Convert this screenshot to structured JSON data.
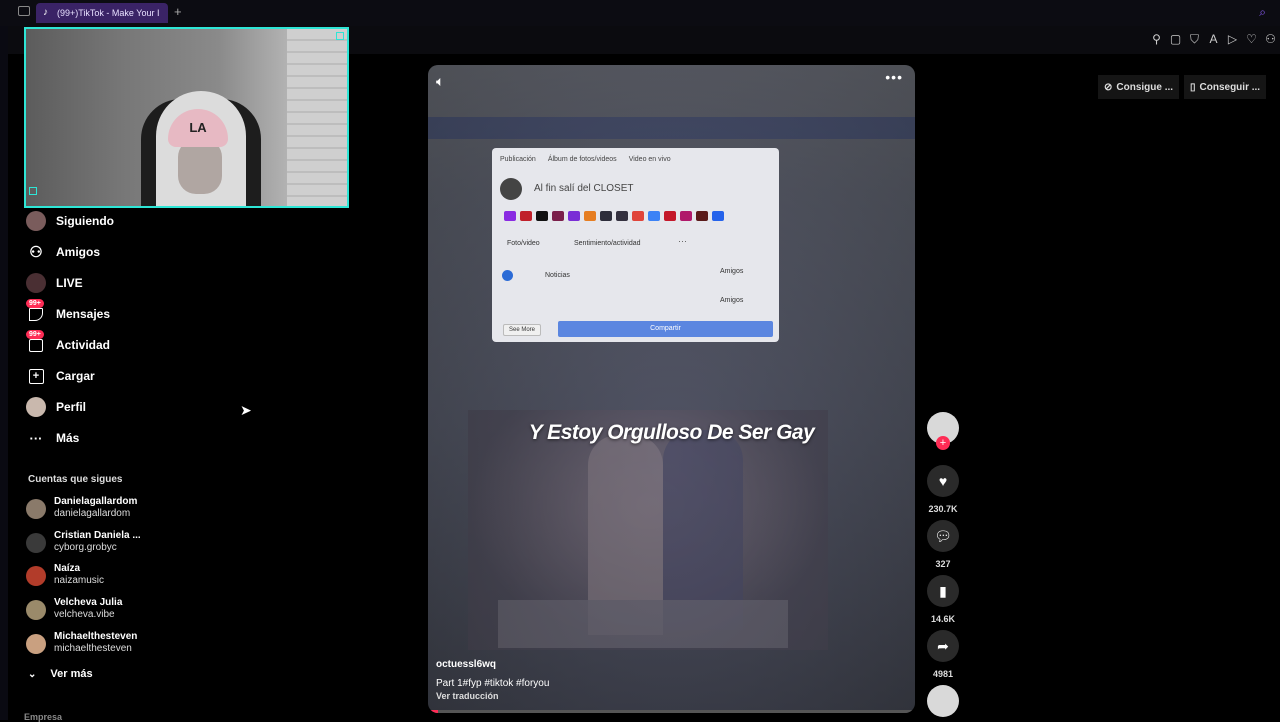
{
  "browser": {
    "tab_title": "(99+)TikTok - Make Your I",
    "new_tab": "+",
    "toolbar_icons": [
      "pin-icon",
      "screenshot-icon",
      "shield-icon",
      "translate-icon",
      "send-icon",
      "heart-icon",
      "profile-icon"
    ]
  },
  "nav": {
    "items": [
      {
        "label": "Siguiendo",
        "icon": "following-avatar-icon"
      },
      {
        "label": "Amigos",
        "icon": "friends-icon"
      },
      {
        "label": "LIVE",
        "icon": "live-icon"
      },
      {
        "label": "Mensajes",
        "icon": "messages-icon",
        "badge": "99+"
      },
      {
        "label": "Actividad",
        "icon": "activity-icon",
        "badge": "99+"
      },
      {
        "label": "Cargar",
        "icon": "upload-icon"
      },
      {
        "label": "Perfil",
        "icon": "profile-icon"
      },
      {
        "label": "Más",
        "icon": "more-icon"
      }
    ]
  },
  "following": {
    "title": "Cuentas que sigues",
    "accounts": [
      {
        "name": "Danielagallardom",
        "handle": "danielagallardom",
        "color": "#8a7a6a"
      },
      {
        "name": "Cristian Daniela ...",
        "handle": "cyborg.grobyc",
        "color": "#3a3a3a"
      },
      {
        "name": "Naíza",
        "handle": "naizamusic",
        "color": "#b23c2a"
      },
      {
        "name": "Velcheva Julia",
        "handle": "velcheva.vibe",
        "color": "#9a8a6a"
      },
      {
        "name": "Michaelthesteven",
        "handle": "michaelthesteven",
        "color": "#c9a080"
      }
    ],
    "see_more": "Ver más"
  },
  "footer": {
    "company": "Empresa"
  },
  "top_buttons": {
    "coins": "Consigue ...",
    "app": "Conseguir ..."
  },
  "video": {
    "caption": "Y Estoy Orgulloso De Ser Gay",
    "author": "octuessl6wq",
    "description": "Part 1#fyp  #tiktok  #foryou",
    "translate": "Ver traducción",
    "progress": 0.02,
    "fb_dialog": {
      "tabs": [
        "Publicación",
        "Álbum de fotos/videos",
        "Video en vivo"
      ],
      "post_text": "Al fin salí del CLOSET",
      "option_photo": "Foto/video",
      "option_feeling": "Sentimiento/actividad",
      "news_label": "Noticias",
      "audience1": "Amigos",
      "audience2": "Amigos",
      "see_more": "See More",
      "share": "Compartir",
      "swatches": [
        "#8a2be2",
        "#c0202a",
        "#111111",
        "#7a1f4a",
        "#7a2ed6",
        "#e67e22",
        "#2d2d3a",
        "#34313f",
        "#e0443a",
        "#3b82f6",
        "#c4182a",
        "#b0186a",
        "#5a1a1a",
        "#2563eb"
      ]
    }
  },
  "actions": {
    "likes": "230.7K",
    "comments": "327",
    "saves": "14.6K",
    "shares": "4981"
  }
}
